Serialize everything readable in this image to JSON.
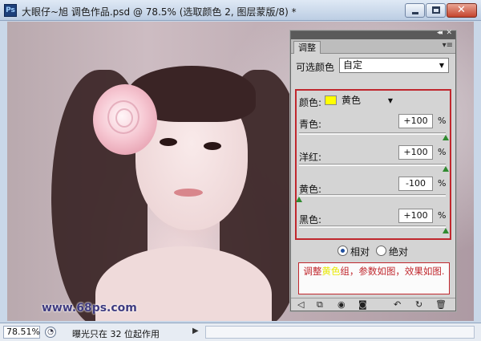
{
  "window": {
    "app_icon": "Ps",
    "title": "大眼仔~旭 调色作品.psd @ 78.5% (选取颜色 2, 图层蒙版/8) *",
    "close_glyph": "✕"
  },
  "canvas": {
    "watermark": "www.68ps.com"
  },
  "panel": {
    "collapse_glyph": "◂◂",
    "close_glyph": "✕",
    "tab_label": "调整",
    "menu_glyph": "▾≡",
    "preset_label": "可选颜色",
    "preset_value": "自定",
    "color_label": "颜色:",
    "color_value": "黄色",
    "color_swatch": "#ffff00",
    "sliders": [
      {
        "label": "青色:",
        "value": "+100",
        "unit": "%",
        "percent": 100
      },
      {
        "label": "洋红:",
        "value": "+100",
        "unit": "%",
        "percent": 100
      },
      {
        "label": "黄色:",
        "value": "-100",
        "unit": "%",
        "percent": -100
      },
      {
        "label": "黑色:",
        "value": "+100",
        "unit": "%",
        "percent": 100
      }
    ],
    "radio_relative": "相对",
    "radio_absolute": "绝对",
    "note_before": "调整",
    "note_highlight": "黄色",
    "note_after": "组，参数如图，效果如图.",
    "highlight_color": "#e8e800",
    "accent_color": "#c0272d"
  },
  "status": {
    "zoom": "78.51%",
    "message": "曝光只在 32 位起作用",
    "arrow": "▶"
  },
  "icons": {
    "back": "◁",
    "clip": "⧉",
    "eye": "◉",
    "visibility": "◙",
    "reset_prev": "↶",
    "reset": "↻",
    "trash": "🗑"
  }
}
